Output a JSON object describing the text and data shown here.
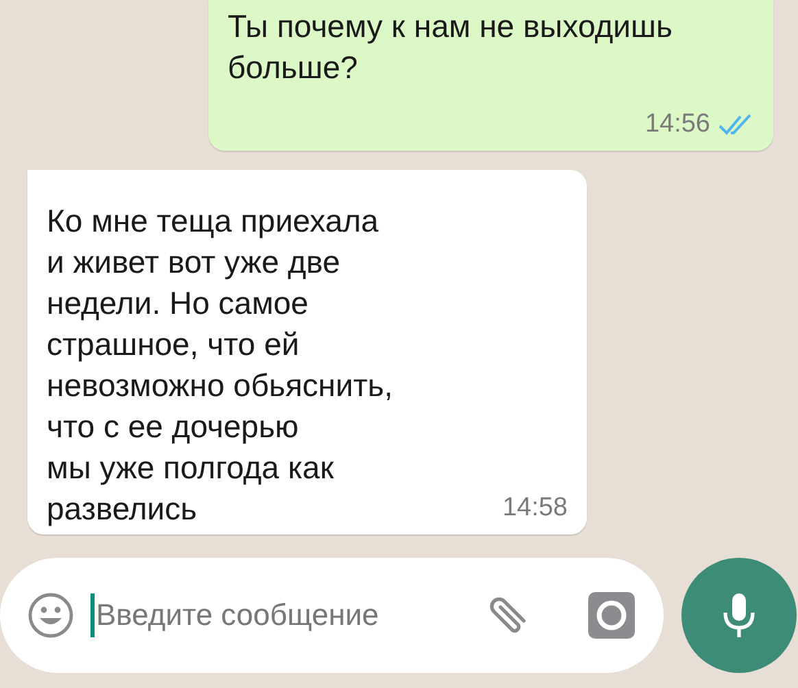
{
  "messages": [
    {
      "kind": "outgoing",
      "lines": [
        "Ты почему к нам не выходишь",
        "больше?"
      ],
      "time": "14:56",
      "read": true
    },
    {
      "kind": "incoming",
      "lines": [
        "Ко мне теща приехала",
        "и живет вот уже две",
        "недели. Но самое",
        "страшное, что ей",
        "невозможно обьяснить,",
        "что с ее дочерью",
        "мы уже полгода как",
        "развелись"
      ],
      "time": "14:58"
    }
  ],
  "composer": {
    "placeholder": "Введите сообщение"
  }
}
